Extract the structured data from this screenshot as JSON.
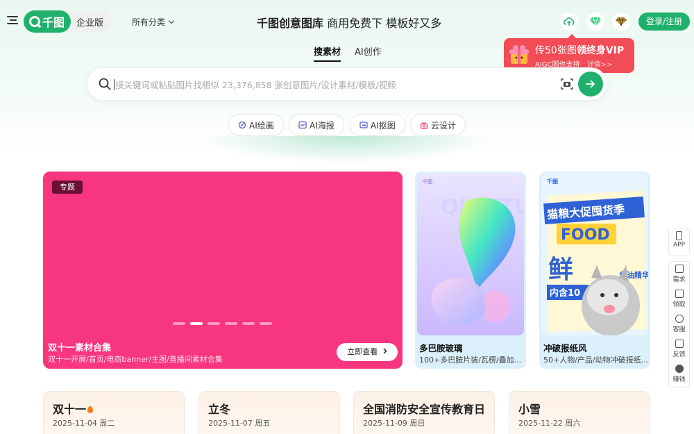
{
  "header": {
    "logo_text": "千图",
    "edition": "企业版",
    "category": "所有分类",
    "slogan_bold": "千图创意图库",
    "slogan_rest": "商用免费下 模板好又多",
    "login": "登录/注册"
  },
  "promo": {
    "title_prefix": "传50张图",
    "title_bold": "领终身VIP",
    "subtitle": "AIGC图也支持",
    "link": "详情>>"
  },
  "tabs": [
    {
      "label": "搜素材",
      "active": true
    },
    {
      "label": "AI创作",
      "active": false
    }
  ],
  "search": {
    "placeholder": "搜关键词或粘贴图片找相似 23,376,858 张创意图片/设计素材/模板/视频",
    "value": ""
  },
  "tools": [
    {
      "label": "AI绘画",
      "icon": "paintbrush-icon"
    },
    {
      "label": "AI海报",
      "icon": "poster-icon"
    },
    {
      "label": "AI抠图",
      "icon": "cutout-icon"
    },
    {
      "label": "云设计",
      "icon": "cloud-design-icon"
    }
  ],
  "banner": {
    "tag": "专题",
    "title": "双十一素材合集",
    "subtitle": "双十一开屏/首页/电商banner/主图/直播间素材合集",
    "button": "立即查看",
    "active_slide": 2,
    "slide_count": 6
  },
  "cards": [
    {
      "title": "多巴胺玻璃",
      "subtitle": "100+多巴胺片装/瓦楞/叠加..."
    },
    {
      "title": "冲破报纸风",
      "subtitle": "50+人物/产品/动物冲破报纸..."
    }
  ],
  "card_art": {
    "logo": "千图",
    "glass_word": "QIANTU",
    "newspaper_headline": "猫粮大促囤货季",
    "newspaper_food": "FOOD",
    "newspaper_big": "鲜",
    "newspaper_bottom": "内含10",
    "newspaper_side": "鱼油精华"
  },
  "sidebar": [
    {
      "label": "APP"
    },
    {
      "label": "需求"
    },
    {
      "label": "领取"
    },
    {
      "label": "客服"
    },
    {
      "label": "反馈"
    },
    {
      "label": "赚钱"
    }
  ],
  "festivals": [
    {
      "name": "双十一",
      "date": "2025-11-04 周二",
      "hot": true
    },
    {
      "name": "立冬",
      "date": "2025-11-07 周五",
      "hot": false
    },
    {
      "name": "全国消防安全宣传教育日",
      "date": "2025-11-09 周日",
      "hot": false
    },
    {
      "name": "小雪",
      "date": "2025-11-22 周六",
      "hot": false
    }
  ],
  "colors": {
    "brand_green": "#1fb16b",
    "promo_red": "#f24c56",
    "banner_pink": "#f8357f"
  }
}
